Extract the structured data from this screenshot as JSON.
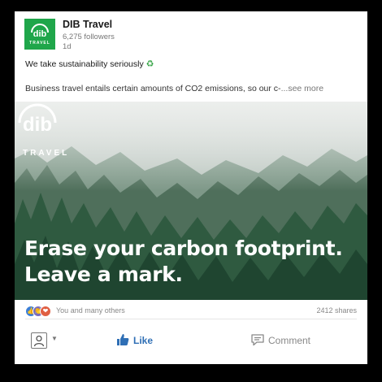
{
  "post": {
    "company_name": "DIB Travel",
    "followers": "6,275 followers",
    "age": "1d",
    "headline": "We take sustainability seriously",
    "headline_emoji": "♻",
    "body": "Business travel entails certain amounts of CO2 emissions, so our c-",
    "see_more": "...see more"
  },
  "logo": {
    "word": "TRAVEL",
    "brand_color": "#1fa64a"
  },
  "image": {
    "brand_word": "TRAVEL",
    "tagline_line1": "Erase your carbon footprint.",
    "tagline_line2": "Leave a mark."
  },
  "stats": {
    "reaction_text": "You and many others",
    "shares": "2412 shares"
  },
  "actions": {
    "like": "Like",
    "comment": "Comment",
    "like_color": "#2f6fb5"
  }
}
